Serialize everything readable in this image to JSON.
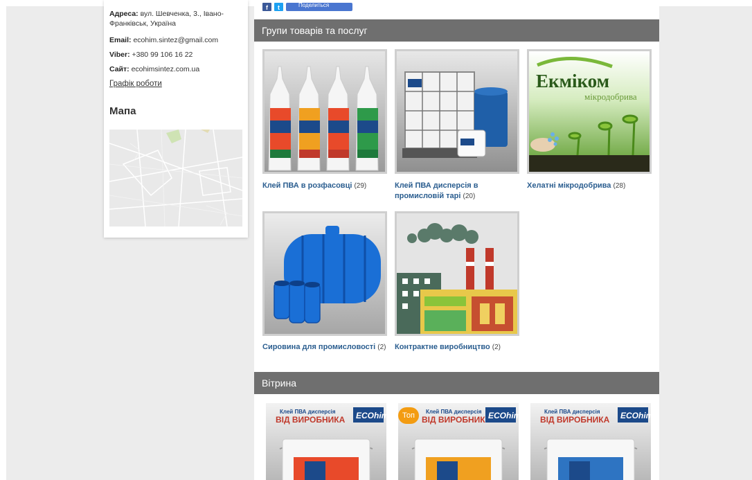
{
  "contact": {
    "address_label": "Адреса:",
    "address_value": "вул. Шевченка, 3., Івано-Франківськ, Україна",
    "email_label": "Email:",
    "email_value": "ecohim.sintez@gmail.com",
    "viber_label": "Viber:",
    "viber_value": "+380 99 106 16 22",
    "site_label": "Сайт:",
    "site_value": "ecohimsintez.com.ua",
    "schedule_link": "Графік роботи",
    "map_title": "Мапа"
  },
  "social": {
    "fb": "f",
    "tw": "t",
    "share_label": "Поделиться"
  },
  "groups": {
    "title": "Групи товарів та послуг",
    "items": [
      {
        "name": "Клей ПВА в розфасовці",
        "count": "(29)",
        "icon": "pva-bottles-image"
      },
      {
        "name": "Клей ПВА дисперсія в промисловій тарі",
        "count": "(20)",
        "icon": "industrial-container-image"
      },
      {
        "name": "Хелатні мікродобрива",
        "count": "(28)",
        "icon": "ekmikom-fertilizer-image"
      },
      {
        "name": "Сировина для промисловості",
        "count": "(2)",
        "icon": "blue-tank-image"
      },
      {
        "name": "Контрактне виробництво",
        "count": "(2)",
        "icon": "factory-image"
      }
    ],
    "ekmikom_brand": "Екміком",
    "ekmikom_sub": "мікродобрива"
  },
  "vitrina": {
    "title": "Вітрина",
    "badge": "Топ",
    "products": [
      {
        "line1": "Клей ПВА дисперсія",
        "line2": "ВІД ВИРОБНИКА",
        "brand": "ECOhim"
      },
      {
        "line1": "Клей ПВА дисперсія",
        "line2": "ВІД ВИРОБНИКА",
        "brand": "ECOhim"
      },
      {
        "line1": "Клей ПВА дисперсія",
        "line2": "ВІД ВИРОБНИКА",
        "brand": "ECOhim"
      }
    ]
  },
  "colors": {
    "header_bg": "#6f6f6f",
    "link": "#2a5d8f",
    "badge": "#f39c12"
  }
}
